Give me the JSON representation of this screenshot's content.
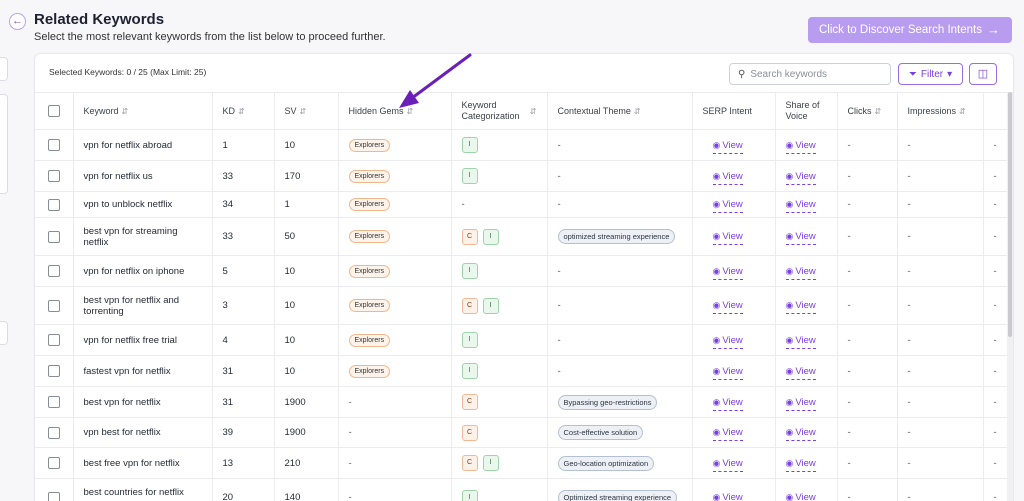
{
  "header": {
    "title": "Related Keywords",
    "subtitle": "Select the most relevant keywords from the list below to proceed further.",
    "discover_label": "Click to Discover Search Intents",
    "discover_icon": "arrow-right-icon"
  },
  "toolbar": {
    "selected_count": "Selected Keywords: 0 / 25 (Max Limit: 25)",
    "search_placeholder": "Search keywords",
    "filter_label": "Filter"
  },
  "columns": {
    "keyword": "Keyword",
    "kd": "KD",
    "sv": "SV",
    "hidden_gems": "Hidden Gems",
    "categorization_1": "Keyword",
    "categorization_2": "Categorization",
    "theme": "Contextual Theme",
    "serp": "SERP Intent",
    "share_1": "Share of",
    "share_2": "Voice",
    "clicks": "Clicks",
    "impressions": "Impressions"
  },
  "labels": {
    "view": "View",
    "dash": "-"
  },
  "rows": [
    {
      "keyword": "vpn for netflix abroad",
      "kd": "1",
      "sv": "10",
      "gem": "Explorers",
      "tags": [
        "I"
      ],
      "theme": "-"
    },
    {
      "keyword": "vpn for netflix us",
      "kd": "33",
      "sv": "170",
      "gem": "Explorers",
      "tags": [
        "I"
      ],
      "theme": "-"
    },
    {
      "keyword": "vpn to unblock netflix",
      "kd": "34",
      "sv": "1",
      "gem": "Explorers",
      "tags": [],
      "theme": "-"
    },
    {
      "keyword": "best vpn for streaming netflix",
      "kd": "33",
      "sv": "50",
      "gem": "Explorers",
      "tags": [
        "C",
        "I"
      ],
      "theme": "optimized streaming experience"
    },
    {
      "keyword": "vpn for netflix on iphone",
      "kd": "5",
      "sv": "10",
      "gem": "Explorers",
      "tags": [
        "I"
      ],
      "theme": "-"
    },
    {
      "keyword": "best vpn for netflix and torrenting",
      "kd": "3",
      "sv": "10",
      "gem": "Explorers",
      "tags": [
        "C",
        "I"
      ],
      "theme": "-"
    },
    {
      "keyword": "vpn for netflix free trial",
      "kd": "4",
      "sv": "10",
      "gem": "Explorers",
      "tags": [
        "I"
      ],
      "theme": "-"
    },
    {
      "keyword": "fastest vpn for netflix",
      "kd": "31",
      "sv": "10",
      "gem": "Explorers",
      "tags": [
        "I"
      ],
      "theme": "-"
    },
    {
      "keyword": "best vpn for netflix",
      "kd": "31",
      "sv": "1900",
      "gem": "-",
      "tags": [
        "C"
      ],
      "theme": "Bypassing geo-restrictions"
    },
    {
      "keyword": "vpn best for netflix",
      "kd": "39",
      "sv": "1900",
      "gem": "-",
      "tags": [
        "C"
      ],
      "theme": "Cost-effective solution"
    },
    {
      "keyword": "best free vpn for netflix",
      "kd": "13",
      "sv": "210",
      "gem": "-",
      "tags": [
        "C",
        "I"
      ],
      "theme": "Geo-location optimization"
    },
    {
      "keyword": "best countries for netflix vpn",
      "kd": "20",
      "sv": "140",
      "gem": "-",
      "tags": [
        "I"
      ],
      "theme": "Optimized streaming experience"
    }
  ],
  "colors": {
    "accent": "#7a3fe0",
    "discover_bg": "#b79cf0",
    "annotation_arrow": "#6a1fb8"
  }
}
